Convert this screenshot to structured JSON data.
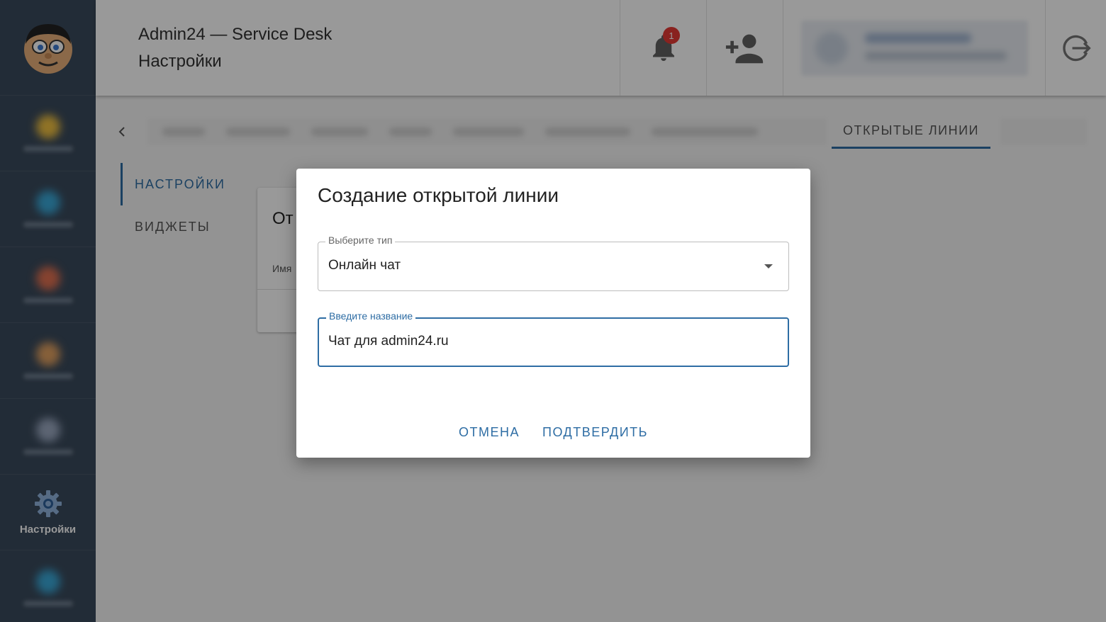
{
  "header": {
    "app_title": "Admin24 — Service Desk",
    "page_title": "Настройки",
    "notification_count": "1"
  },
  "sidebar": {
    "active_label": "Настройки"
  },
  "tabs": {
    "active_label": "ОТКРЫТЫЕ ЛИНИИ"
  },
  "submenu": {
    "items": [
      "НАСТРОЙКИ",
      "ВИДЖЕТЫ"
    ]
  },
  "background_card": {
    "title_partial": "От",
    "field_partial": "Имя"
  },
  "dialog": {
    "title": "Создание открытой линии",
    "type_field": {
      "label": "Выберите тип",
      "value": "Онлайн чат"
    },
    "name_field": {
      "label": "Введите название",
      "value": "Чат для admin24.ru"
    },
    "cancel_label": "ОТМЕНА",
    "confirm_label": "ПОДТВЕРДИТЬ"
  },
  "colors": {
    "accent": "#2e6da4",
    "sidebar": "#3a4a5c",
    "badge": "#e53935"
  }
}
